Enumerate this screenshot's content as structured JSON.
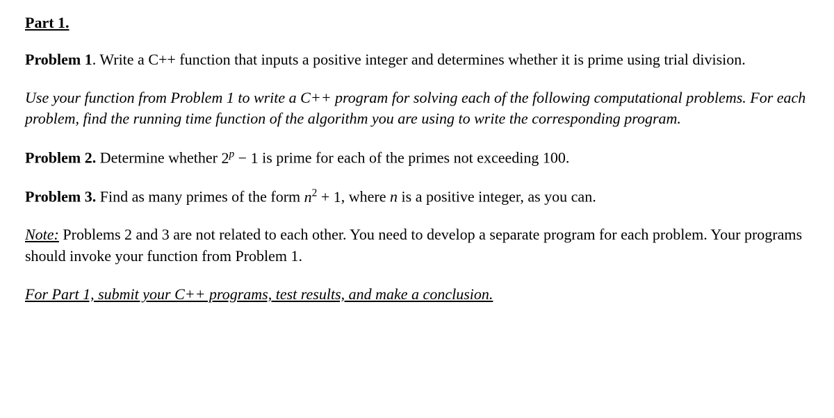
{
  "partTitle": "Part 1.",
  "problem1": {
    "label": "Problem 1",
    "text": ". Write a C++ function that inputs a positive integer and determines whether it is prime using trial division."
  },
  "instructions": "Use your function from Problem 1 to write a C++ program for solving each of the following computational problems. For each problem, find the running time function of the algorithm you are using to write the corresponding program.",
  "problem2": {
    "label": "Problem 2.",
    "textBefore": " Determine whether  ",
    "base2": "2",
    "supP": "p",
    "minus": " − 1",
    "textAfter": " is prime for each of the primes not exceeding 100."
  },
  "problem3": {
    "label": "Problem 3.",
    "textBefore": " Find as many primes of the form  ",
    "baseN": "n",
    "sup2": "2",
    "plus": " + 1",
    "textMid": ", where ",
    "nVar": "n",
    "textAfter": " is a positive integer, as you can."
  },
  "note": {
    "label": "Note:",
    "text": " Problems 2 and 3 are not related to each other. You need to develop a separate program for each problem. Your programs should invoke your function from Problem 1."
  },
  "footer": "For Part 1, submit your C++ programs, test results, and make a conclusion."
}
